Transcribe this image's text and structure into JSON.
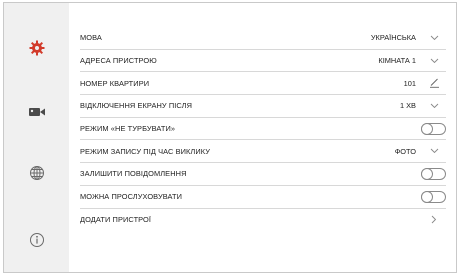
{
  "sidebar": {
    "items": [
      {
        "icon": "gear-icon",
        "color": "#d23a2a"
      },
      {
        "icon": "video-camera-icon",
        "color": "#4a4a4a"
      },
      {
        "icon": "globe-icon",
        "color": "#6a6a6a"
      },
      {
        "icon": "info-icon",
        "color": "#6a6a6a"
      }
    ]
  },
  "settings": {
    "language": {
      "label": "МОВА",
      "value": "УКРАЇНСЬКА"
    },
    "device_address": {
      "label": "АДРЕСА ПРИСТРОЮ",
      "value": "КІМНАТА 1"
    },
    "apartment_number": {
      "label": "НОМЕР КВАРТИРИ",
      "value": "101"
    },
    "screen_off": {
      "label": "ВІДКЛЮЧЕННЯ ЕКРАНУ ПІСЛЯ",
      "value": "1 ХВ"
    },
    "do_not_disturb": {
      "label": "РЕЖИМ «НЕ ТУРБУВАТИ»",
      "enabled": false
    },
    "record_mode": {
      "label": "РЕЖИМ ЗАПИСУ ПІД ЧАС ВИКЛИКУ",
      "value": "ФОТО"
    },
    "leave_message": {
      "label": "ЗАЛИШИТИ ПОВІДОМЛЕННЯ",
      "enabled": false
    },
    "can_monitor": {
      "label": "МОЖНА ПРОСЛУХОВУВАТИ",
      "enabled": false
    },
    "add_devices": {
      "label": "ДОДАТИ ПРИСТРОЇ"
    }
  }
}
